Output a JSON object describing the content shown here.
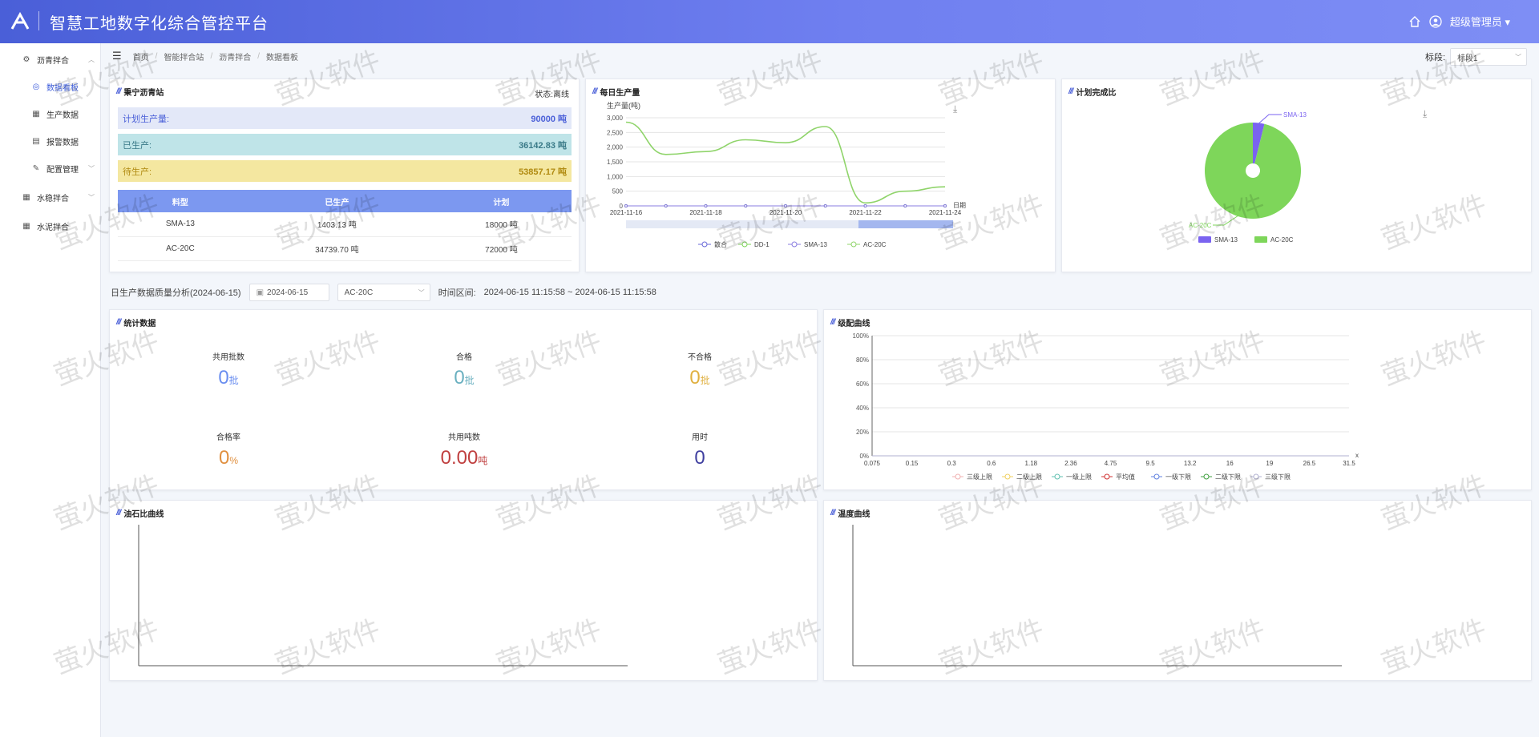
{
  "header": {
    "title": "智慧工地数字化综合管控平台",
    "user": "超级管理员"
  },
  "sidebar": {
    "items": [
      {
        "label": "沥青拌合",
        "icon": "gear-icon",
        "level": 1,
        "expanded": true
      },
      {
        "label": "数据看板",
        "icon": "radio-icon",
        "level": 2,
        "active": true
      },
      {
        "label": "生产数据",
        "icon": "table-icon",
        "level": 2
      },
      {
        "label": "报警数据",
        "icon": "doc-icon",
        "level": 2
      },
      {
        "label": "配置管理",
        "icon": "edit-icon",
        "level": 2,
        "expandable": true
      },
      {
        "label": "水稳拌合",
        "icon": "grid-icon",
        "level": 1,
        "expandable": true
      },
      {
        "label": "水泥拌合",
        "icon": "grid-icon",
        "level": 1
      }
    ]
  },
  "breadcrumb": [
    "首页",
    "智能拌合站",
    "沥青拌合",
    "数据看板"
  ],
  "section_select": {
    "label": "标段:",
    "value": "标段1"
  },
  "station": {
    "title": "秉宁沥青站",
    "status": "状态:离线",
    "planned": {
      "label": "计划生产量:",
      "value": "90000 吨"
    },
    "produced": {
      "label": "已生产:",
      "value": "36142.83 吨"
    },
    "pending": {
      "label": "待生产:",
      "value": "53857.17 吨"
    },
    "table": {
      "headers": [
        "料型",
        "已生产",
        "计划"
      ],
      "rows": [
        [
          "SMA-13",
          "1403.13 吨",
          "18000 吨"
        ],
        [
          "AC-20C",
          "34739.70 吨",
          "72000 吨"
        ]
      ]
    }
  },
  "daily": {
    "title": "每日生产量"
  },
  "plan": {
    "title": "计划完成比"
  },
  "toolbar": {
    "title": "日生产数据质量分析(2024-06-15)",
    "date": "2024-06-15",
    "mix": "AC-20C",
    "range_label": "时间区间:",
    "range": "2024-06-15 11:15:58 ~ 2024-06-15 11:15:58"
  },
  "stats": {
    "title": "统计数据",
    "items": [
      {
        "label": "共用批数",
        "value": "0",
        "unit": "批",
        "color": "#6a8ef0"
      },
      {
        "label": "合格",
        "value": "0",
        "unit": "批",
        "color": "#6ab0c0"
      },
      {
        "label": "不合格",
        "value": "0",
        "unit": "批",
        "color": "#e0b040"
      },
      {
        "label": "合格率",
        "value": "0",
        "unit": "%",
        "color": "#e09040"
      },
      {
        "label": "共用吨数",
        "value": "0.00",
        "unit": "吨",
        "color": "#c04040"
      },
      {
        "label": "用时",
        "value": "0",
        "unit": "",
        "color": "#4040a0"
      }
    ]
  },
  "grading": {
    "title": "级配曲线"
  },
  "oilstone": {
    "title": "油石比曲线"
  },
  "temperature": {
    "title": "温度曲线"
  },
  "watermark": "萤火软件",
  "colors": {
    "accent": "#4a5fd8",
    "planned_bg": "#e3e8f8",
    "produced_bg": "#bfe4e8",
    "pending_bg": "#f4e7a0",
    "table_head": "#7c98f0"
  },
  "chart_data": [
    {
      "type": "line",
      "title": "每日生产量",
      "ylabel": "生产量(吨)",
      "xlabel": "日期",
      "x": [
        "2021-11-16",
        "2021-11-17",
        "2021-11-18",
        "2021-11-19",
        "2021-11-20",
        "2021-11-21",
        "2021-11-22",
        "2021-11-23",
        "2021-11-24"
      ],
      "x_tick_labels": [
        "2021-11-16",
        "2021-11-18",
        "2021-11-20",
        "2021-11-22",
        "2021-11-24"
      ],
      "ylim": [
        0,
        3000
      ],
      "y_ticks": [
        0,
        500,
        1000,
        1500,
        2000,
        2500,
        3000
      ],
      "series": [
        {
          "name": "散合",
          "color": "#6a6ad8",
          "values": [
            0,
            0,
            0,
            0,
            0,
            0,
            0,
            0,
            0
          ]
        },
        {
          "name": "DD-1",
          "color": "#7fd45a",
          "values": [
            0,
            0,
            0,
            0,
            0,
            0,
            0,
            0,
            0
          ]
        },
        {
          "name": "SMA-13",
          "color": "#8a7de0",
          "values": [
            0,
            0,
            0,
            0,
            0,
            0,
            0,
            0,
            0
          ]
        },
        {
          "name": "AC-20C",
          "color": "#8fd46a",
          "values": [
            2850,
            1750,
            1850,
            2250,
            2150,
            2700,
            100,
            500,
            650
          ]
        }
      ],
      "legend": "bottom",
      "grid": true
    },
    {
      "type": "pie",
      "title": "计划完成比",
      "slices": [
        {
          "name": "SMA-13",
          "value": 1403.13,
          "color": "#7a63f0"
        },
        {
          "name": "AC-20C",
          "value": 34739.7,
          "color": "#7ed65a"
        }
      ],
      "labels": [
        "SMA-13",
        "AC-20C"
      ],
      "legend": "bottom"
    },
    {
      "type": "line",
      "title": "级配曲线",
      "x": [
        "0.075",
        "0.15",
        "0.3",
        "0.6",
        "1.18",
        "2.36",
        "4.75",
        "9.5",
        "13.2",
        "16",
        "19",
        "26.5",
        "31.5"
      ],
      "ylim": [
        0,
        100
      ],
      "y_ticks": [
        "0%",
        "20%",
        "40%",
        "60%",
        "80%",
        "100%"
      ],
      "xlabel": "x",
      "series": [
        {
          "name": "三级上限",
          "color": "#f0b0b0",
          "values": [
            0,
            0,
            0,
            0,
            0,
            0,
            0,
            0,
            0,
            0,
            0,
            0,
            0
          ]
        },
        {
          "name": "二级上限",
          "color": "#f0d060",
          "values": [
            0,
            0,
            0,
            0,
            0,
            0,
            0,
            0,
            0,
            0,
            0,
            0,
            0
          ]
        },
        {
          "name": "一级上限",
          "color": "#60c0b0",
          "values": [
            0,
            0,
            0,
            0,
            0,
            0,
            0,
            0,
            0,
            0,
            0,
            0,
            0
          ]
        },
        {
          "name": "平均值",
          "color": "#d03030",
          "values": [
            0,
            0,
            0,
            0,
            0,
            0,
            0,
            0,
            0,
            0,
            0,
            0,
            0
          ]
        },
        {
          "name": "一级下限",
          "color": "#6080e0",
          "values": [
            0,
            0,
            0,
            0,
            0,
            0,
            0,
            0,
            0,
            0,
            0,
            0,
            0
          ]
        },
        {
          "name": "二级下限",
          "color": "#40a040",
          "values": [
            0,
            0,
            0,
            0,
            0,
            0,
            0,
            0,
            0,
            0,
            0,
            0,
            0
          ]
        },
        {
          "name": "三级下限",
          "color": "#b0b0d0",
          "values": [
            0,
            0,
            0,
            0,
            0,
            0,
            0,
            0,
            0,
            0,
            0,
            0,
            0
          ]
        }
      ],
      "legend": "bottom",
      "grid": true
    },
    {
      "type": "line",
      "title": "油石比曲线",
      "series": []
    },
    {
      "type": "line",
      "title": "温度曲线",
      "series": []
    }
  ]
}
